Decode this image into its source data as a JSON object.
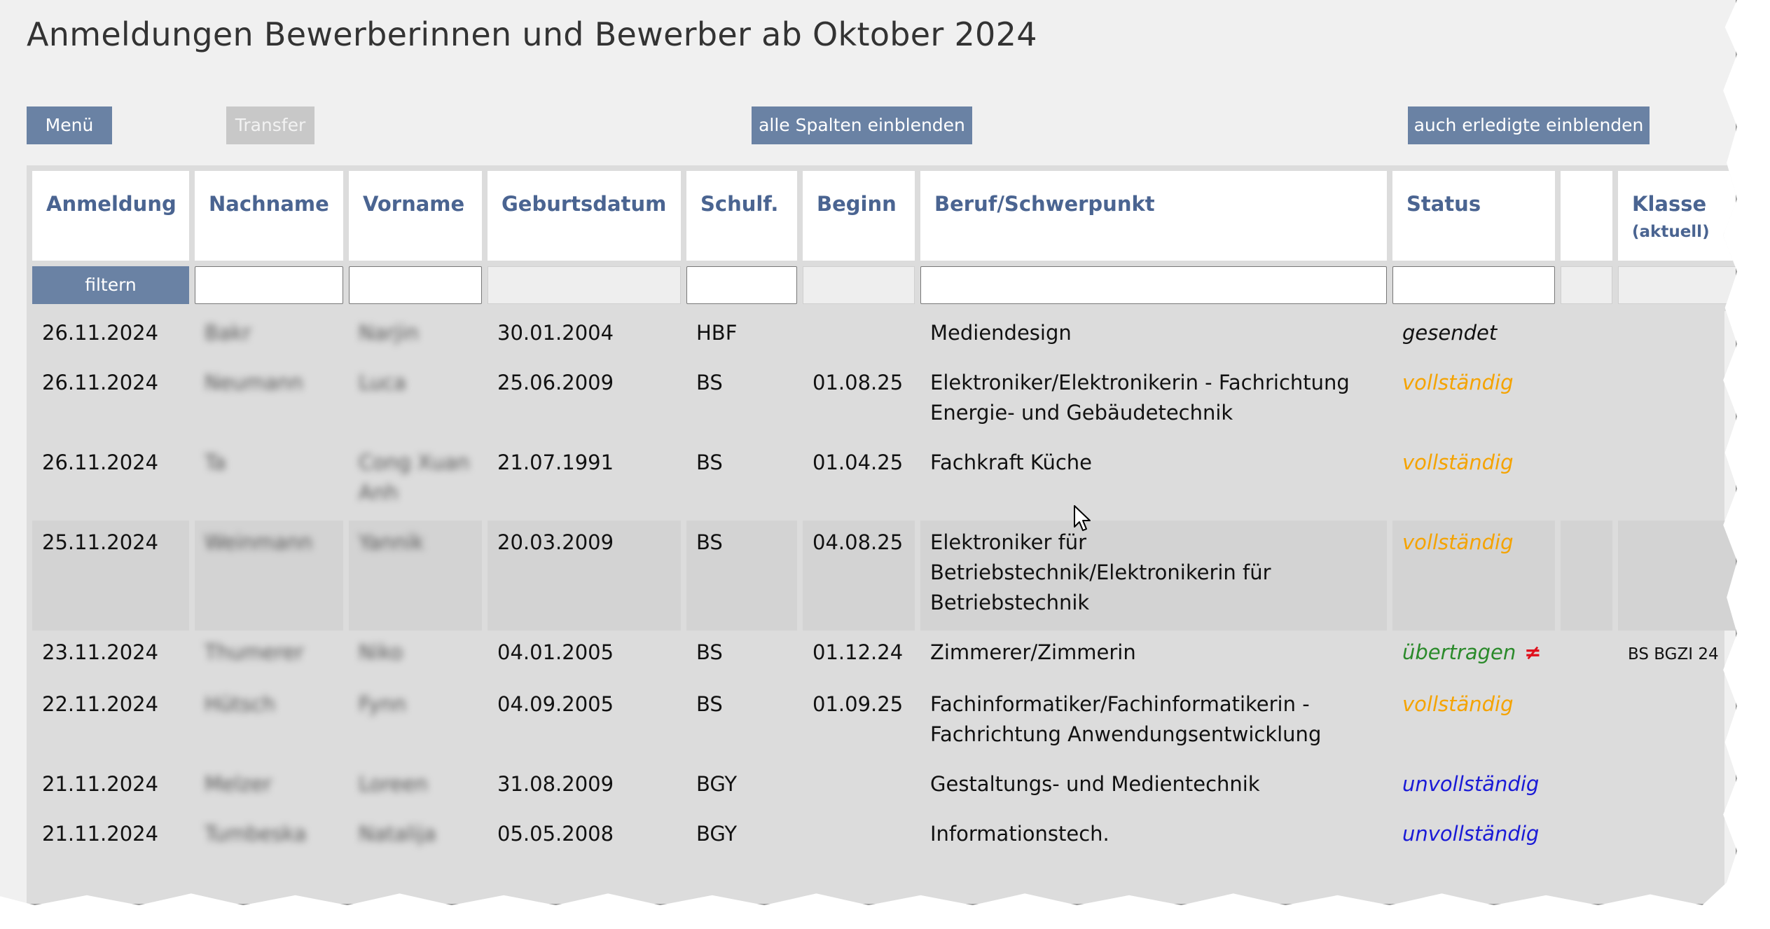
{
  "page": {
    "title": "Anmeldungen Bewerberinnen und Bewerber ab Oktober 2024"
  },
  "toolbar": {
    "menu_label": "Menü",
    "transfer_label": "Transfer",
    "show_columns_label": "alle Spalten einblenden",
    "show_done_label": "auch erledigte einblenden"
  },
  "table": {
    "headers": {
      "anmeldung": "Anmeldung",
      "nachname": "Nachname",
      "vorname": "Vorname",
      "geburtsdatum": "Geburtsdatum",
      "schulf": "Schulf.",
      "beginn": "Beginn",
      "beruf": "Beruf/Schwerpunkt",
      "status": "Status",
      "extra": "",
      "klasse": "Klasse",
      "klasse_sub": "(aktuell)"
    },
    "filter_label": "filtern",
    "status_colors": {
      "gesendet": "#111111",
      "vollständig": "#f5a300",
      "übertragen": "#2a8a2a",
      "unvollständig": "#1a1ad6"
    },
    "rows": [
      {
        "anmeldung": "26.11.2024",
        "nachname": "Bakr",
        "vorname": "Narjin",
        "geburtsdatum": "30.01.2004",
        "schulf": "HBF",
        "beginn": "",
        "beruf": "Mediendesign",
        "status": "gesendet",
        "status_key": "gesendet",
        "mismatch": "",
        "klasse": ""
      },
      {
        "anmeldung": "26.11.2024",
        "nachname": "Neumann",
        "vorname": "Luca",
        "geburtsdatum": "25.06.2009",
        "schulf": "BS",
        "beginn": "01.08.25",
        "beruf": "Elektroniker/Elektronikerin - Fachrichtung Energie- und Gebäudetechnik",
        "status": "vollständig",
        "status_key": "vollständig",
        "mismatch": "",
        "klasse": ""
      },
      {
        "anmeldung": "26.11.2024",
        "nachname": "Ta",
        "vorname": "Cong Xuan Anh",
        "geburtsdatum": "21.07.1991",
        "schulf": "BS",
        "beginn": "01.04.25",
        "beruf": "Fachkraft Küche",
        "status": "vollständig",
        "status_key": "vollständig",
        "mismatch": "",
        "klasse": ""
      },
      {
        "anmeldung": "25.11.2024",
        "nachname": "Weinmann",
        "vorname": "Yannik",
        "geburtsdatum": "20.03.2009",
        "schulf": "BS",
        "beginn": "04.08.25",
        "beruf": "Elektroniker für Betriebstechnik/Elektronikerin für Betriebstechnik",
        "status": "vollständig",
        "status_key": "vollständig",
        "mismatch": "",
        "klasse": ""
      },
      {
        "anmeldung": "23.11.2024",
        "nachname": "Thumerer",
        "vorname": "Niko",
        "geburtsdatum": "04.01.2005",
        "schulf": "BS",
        "beginn": "01.12.24",
        "beruf": "Zimmerer/Zimmerin",
        "status": "übertragen",
        "status_key": "übertragen",
        "mismatch": "≠",
        "klasse": "BS BGZI 24"
      },
      {
        "anmeldung": "22.11.2024",
        "nachname": "Hütsch",
        "vorname": "Fynn",
        "geburtsdatum": "04.09.2005",
        "schulf": "BS",
        "beginn": "01.09.25",
        "beruf": "Fachinformatiker/Fachinformatikerin - Fachrichtung Anwendungsentwicklung",
        "status": "vollständig",
        "status_key": "vollständig",
        "mismatch": "",
        "klasse": ""
      },
      {
        "anmeldung": "21.11.2024",
        "nachname": "Melzer",
        "vorname": "Loreen",
        "geburtsdatum": "31.08.2009",
        "schulf": "BGY",
        "beginn": "",
        "beruf": "Gestaltungs- und Medientechnik",
        "status": "unvollständig",
        "status_key": "unvollständig",
        "mismatch": "",
        "klasse": ""
      },
      {
        "anmeldung": "21.11.2024",
        "nachname": "Tumbeska",
        "vorname": "Natalija",
        "geburtsdatum": "05.05.2008",
        "schulf": "BGY",
        "beginn": "",
        "beruf": "Informationstech.",
        "status": "unvollständig",
        "status_key": "unvollständig",
        "mismatch": "",
        "klasse": ""
      }
    ],
    "highlighted_row": 3
  },
  "icons": {
    "cursor": "mouse-pointer-icon"
  }
}
